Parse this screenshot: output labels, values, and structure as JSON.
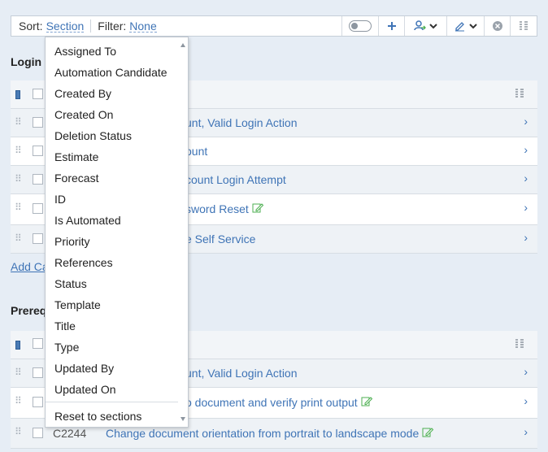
{
  "toolbar": {
    "sort_label": "Sort:",
    "sort_value": "Section",
    "filter_label": "Filter:",
    "filter_value": "None"
  },
  "sections": [
    {
      "title": "Login",
      "add_link": "Add Ca",
      "rows": [
        {
          "id": "",
          "title": "unt, Valid Login Action",
          "edited": false
        },
        {
          "id": "",
          "title": "ount",
          "edited": false
        },
        {
          "id": "",
          "title": "count Login Attempt",
          "edited": false
        },
        {
          "id": "",
          "title": "sword Reset",
          "edited": true
        },
        {
          "id": "",
          "title": "e Self Service",
          "edited": false
        }
      ]
    },
    {
      "title": "Prereq",
      "rows": [
        {
          "id": "",
          "title": "unt, Valid Login Action",
          "edited": false
        },
        {
          "id": "",
          "title": "o document and verify print output",
          "edited": true
        },
        {
          "id": "C2244",
          "title": "Change document orientation from portrait to landscape mode",
          "edited": true
        }
      ]
    }
  ],
  "sort_menu": {
    "options": [
      "Assigned To",
      "Automation Candidate",
      "Created By",
      "Created On",
      "Deletion Status",
      "Estimate",
      "Forecast",
      "ID",
      "Is Automated",
      "Priority",
      "References",
      "Status",
      "Template",
      "Title",
      "Type",
      "Updated By",
      "Updated On"
    ],
    "reset": "Reset to sections"
  },
  "colors": {
    "link": "#3f74b6",
    "background": "#e6edf5",
    "edit_icon": "#4caf50"
  },
  "icons": [
    "toggle-icon",
    "plus-icon",
    "assign-user-icon",
    "chevron-down-icon",
    "pencil-icon",
    "clear-icon",
    "columns-icon",
    "drag-handle-icon",
    "chevron-right-icon",
    "edit-icon"
  ]
}
